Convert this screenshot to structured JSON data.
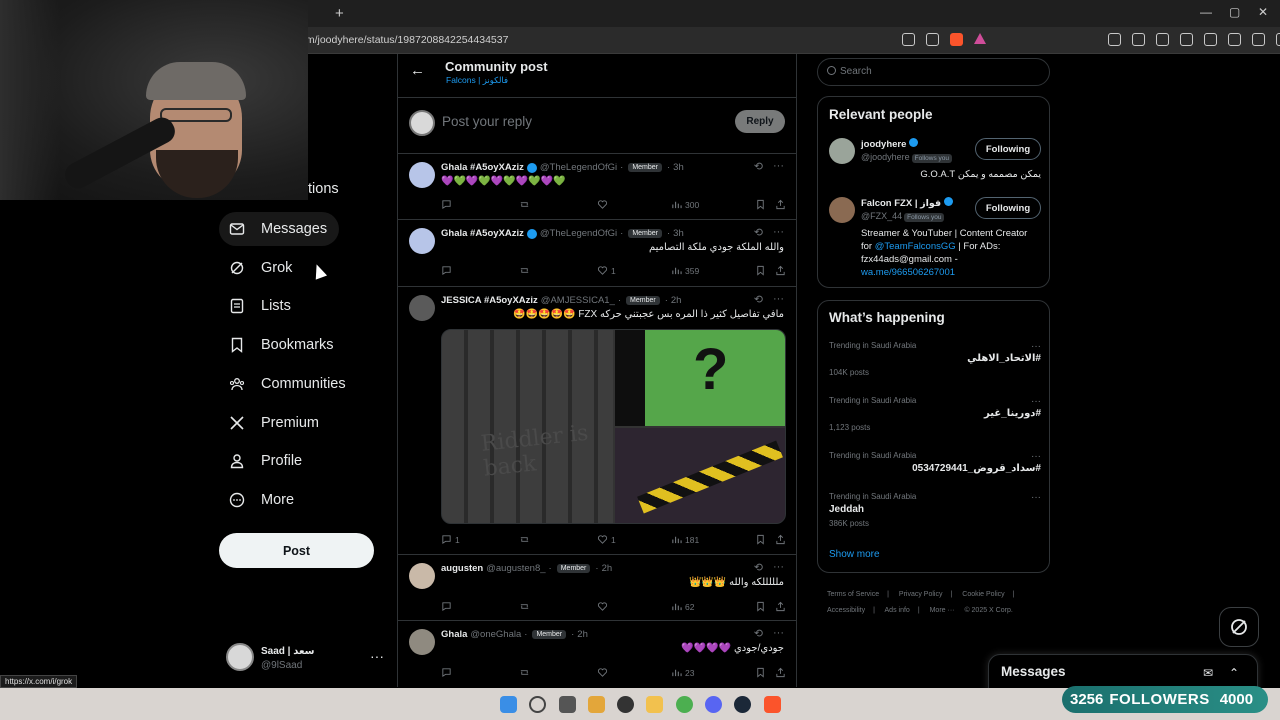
{
  "browser": {
    "new_tab": "+",
    "url": "om/joodyhere/status/1987208842254434537",
    "status_url": "https://x.com/i/grok",
    "win_min": "—",
    "win_max": "▢",
    "win_close": "✕"
  },
  "nav": {
    "partial_item": "tions",
    "items": [
      {
        "label": "Messages",
        "icon": "mail-icon"
      },
      {
        "label": "Grok",
        "icon": "grok-icon"
      },
      {
        "label": "Lists",
        "icon": "list-icon"
      },
      {
        "label": "Bookmarks",
        "icon": "bookmark-icon"
      },
      {
        "label": "Communities",
        "icon": "people-icon"
      },
      {
        "label": "Premium",
        "icon": "x-logo-icon"
      },
      {
        "label": "Profile",
        "icon": "person-icon"
      },
      {
        "label": "More",
        "icon": "more-circle-icon"
      }
    ],
    "post_label": "Post",
    "account": {
      "name": "Saad | سعد",
      "handle": "@9lSaad",
      "menu": "···"
    }
  },
  "header": {
    "back": "←",
    "title": "Community post",
    "subtitle": "Falcons | فالكونز"
  },
  "reply": {
    "placeholder": "Post your reply",
    "button": "Reply"
  },
  "tweets": [
    {
      "name": "Ghala #A5oyXAziz",
      "handle": "@TheLegendOfGi",
      "badge": "Member",
      "time": "3h",
      "text": "💜💚💜💚💜💚💜💚💜💚",
      "replies": "",
      "reposts": "",
      "likes": "",
      "views": "300"
    },
    {
      "name": "Ghala #A5oyXAziz",
      "handle": "@TheLegendOfGi",
      "badge": "Member",
      "time": "3h",
      "text": "والله الملكة جودي ملكة التصاميم",
      "replies": "",
      "reposts": "",
      "likes": "1",
      "views": "359"
    },
    {
      "name": "JESSICA #A5oyXAziz",
      "handle": "@AMJESSICA1_",
      "badge": "Member",
      "time": "2h",
      "text": "مافي تفاصيل كثير ذا المره بس عجبتني حركه FZX 🤩🤩🤩🤩🤩",
      "replies": "1",
      "reposts": "",
      "likes": "1",
      "views": "181",
      "media_text": "Riddler is back"
    },
    {
      "name": "augusten",
      "handle": "@augusten8_",
      "badge": "Member",
      "time": "2h",
      "text": "ملللللكه والله 👑👑👑",
      "replies": "",
      "reposts": "",
      "likes": "",
      "views": "62"
    },
    {
      "name": "Ghala",
      "handle": "@oneGhala",
      "badge": "Member",
      "time": "2h",
      "text": "جودي/جودي 💜💜💜💜",
      "replies": "",
      "reposts": "",
      "likes": "",
      "views": "23"
    }
  ],
  "search": {
    "placeholder": "Search"
  },
  "relevant": {
    "title": "Relevant people",
    "people": [
      {
        "name": "joodyhere",
        "handle": "@joodyhere",
        "follows_you": "Follows you",
        "button": "Following",
        "bio": "يمكن مصممه و يمكن G.O.A.T"
      },
      {
        "name": "Falcon FZX | فواز",
        "handle": "@FZX_44",
        "follows_you": "Follows you",
        "button": "Following",
        "bio_1": "Streamer & YouTuber | Content Creator for ",
        "bio_link": "@TeamFalconsGG",
        "bio_2": " | For ADs: fzx44ads@gmail.com - ",
        "bio_link2": "wa.me/966506267001"
      }
    ]
  },
  "happening": {
    "title": "What’s happening",
    "trends": [
      {
        "context": "Trending in Saudi Arabia",
        "topic": "#الاتحاد_الاهلي",
        "count": "104K posts"
      },
      {
        "context": "Trending in Saudi Arabia",
        "topic": "#دورينا_غير",
        "count": "1,123 posts"
      },
      {
        "context": "Trending in Saudi Arabia",
        "topic": "#سداد_قروض_0534729441",
        "count": ""
      },
      {
        "context": "Trending in Saudi Arabia",
        "topic": "Jeddah",
        "count": "386K posts"
      }
    ],
    "show_more": "Show more"
  },
  "footer": [
    "Terms of Service",
    "|",
    "Privacy Policy",
    "|",
    "Cookie Policy",
    "|",
    "Accessibility",
    "|",
    "Ads info",
    "|",
    "More ···",
    "© 2025 X Corp."
  ],
  "messages_drawer": {
    "title": "Messages"
  },
  "overlay": {
    "followers_count": "3256",
    "followers_label": "FOLLOWERS",
    "followers_goal": "4000"
  },
  "colors": {
    "accent": "#1d9bf0",
    "bg": "#000000",
    "border": "#2f3336",
    "muted": "#71767b",
    "followers_bar": "#2a8f86"
  }
}
